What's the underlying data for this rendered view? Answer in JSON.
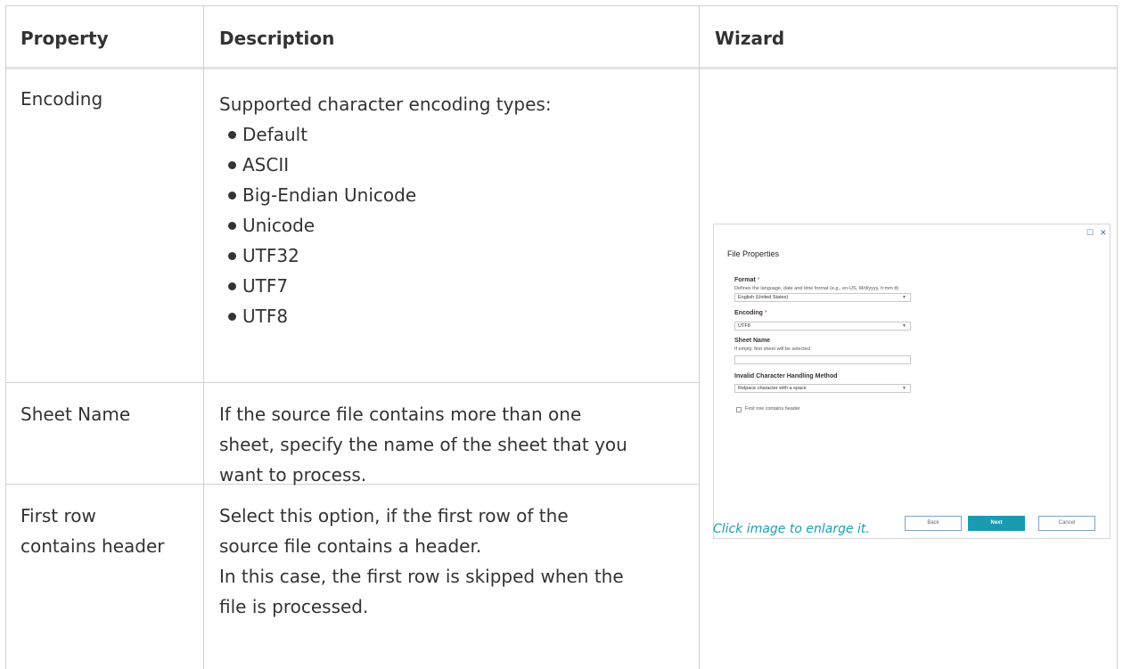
{
  "table": {
    "headers": [
      "Property",
      "Description",
      "Wizard"
    ],
    "rows": [
      {
        "property": "Encoding",
        "description_intro": "Supported character encoding types:",
        "description_items": [
          "Default",
          "ASCII",
          "Big-Endian Unicode",
          "Unicode",
          "UTF32",
          "UTF7",
          "UTF8"
        ]
      },
      {
        "property": "Sheet Name",
        "description_lines": [
          "If the source file contains more than one",
          "sheet, specify the name of the sheet that you",
          "want to process."
        ]
      },
      {
        "property_lines": [
          "First row",
          "contains header"
        ],
        "description_lines": [
          "Select this option, if the first row of the",
          "source file contains a header.",
          "In this case, the first row is skipped when the",
          "file is processed."
        ]
      }
    ]
  },
  "wizard": {
    "window_icons": [
      "maximize-icon",
      "close-icon"
    ],
    "maximize_glyph": "☐",
    "close_glyph": "✕",
    "title": "File Properties",
    "format": {
      "label": "Format",
      "required_mark": "*",
      "hint": "Defines the language, date and time format (e.g., en-US, M/d/yyyy, h:mm tt)",
      "value": "English (United States)"
    },
    "encoding": {
      "label": "Encoding",
      "required_mark": "*",
      "value": "UTF8"
    },
    "sheet_name": {
      "label": "Sheet Name",
      "hint": "If empty, first sheet will be selected",
      "value": ""
    },
    "invalid_char": {
      "label": "Invalid Character Handling Method",
      "value": "Relpace character with a space"
    },
    "first_row_header": {
      "label": "First row contains header",
      "checked": false
    },
    "buttons": {
      "back": "Back",
      "next": "Next",
      "cancel": "Cancel"
    },
    "caption": "Click image to enlarge it.",
    "colors": {
      "accent": "#1a9bb0",
      "caption": "#1aa0b4",
      "required": "#d04040"
    }
  }
}
